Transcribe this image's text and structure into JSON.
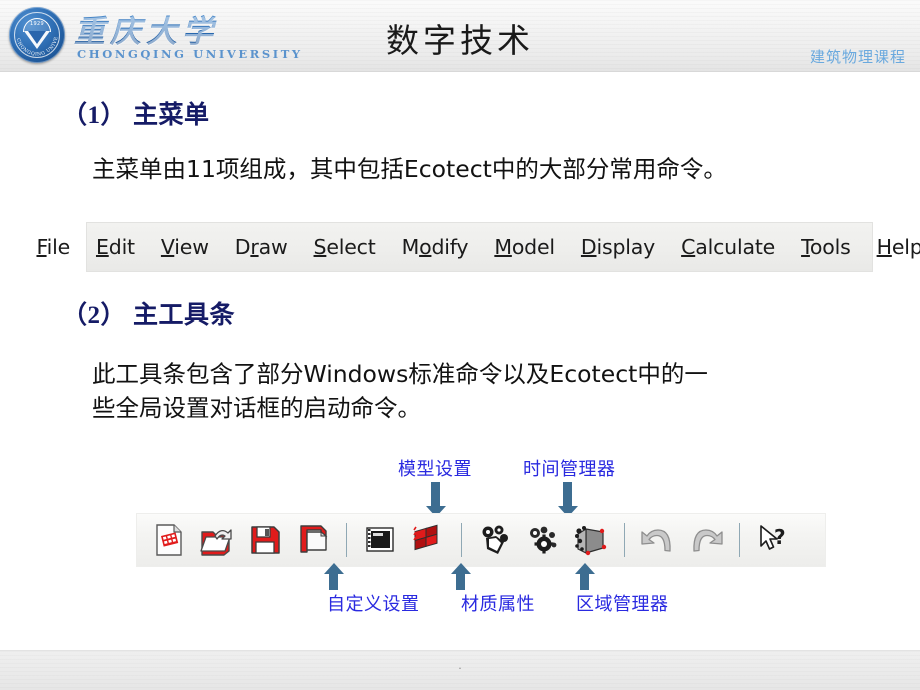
{
  "header": {
    "title": "数字技术",
    "course_label": "建筑物理课程",
    "logo": {
      "seal_year": "1929",
      "seal_arc_text": "CHONGQING UNIVERSITY",
      "wordmark_cn": "重庆大学",
      "wordmark_en": "CHONGQING UNIVERSITY"
    }
  },
  "sections": [
    {
      "number": "（1）",
      "title": "主菜单",
      "paragraph": "主菜单由11项组成，其中包括Ecotect中的大部分常用命令。"
    },
    {
      "number": "（2）",
      "title": "主工具条",
      "paragraph": "此工具条包含了部分Windows标准命令以及Ecotect中的一\n些全局设置对话框的启动命令。"
    }
  ],
  "menubar": {
    "items": [
      {
        "label": "File",
        "pre": "",
        "accel": "F",
        "post": "ile"
      },
      {
        "label": "Edit",
        "pre": "",
        "accel": "E",
        "post": "dit"
      },
      {
        "label": "View",
        "pre": "",
        "accel": "V",
        "post": "iew"
      },
      {
        "label": "Draw",
        "pre": "D",
        "accel": "r",
        "post": "aw"
      },
      {
        "label": "Select",
        "pre": "",
        "accel": "S",
        "post": "elect"
      },
      {
        "label": "Modify",
        "pre": "M",
        "accel": "o",
        "post": "dify"
      },
      {
        "label": "Model",
        "pre": "",
        "accel": "M",
        "post": "odel"
      },
      {
        "label": "Display",
        "pre": "",
        "accel": "D",
        "post": "isplay"
      },
      {
        "label": "Calculate",
        "pre": "",
        "accel": "C",
        "post": "alculate"
      },
      {
        "label": "Tools",
        "pre": "",
        "accel": "T",
        "post": "ools"
      },
      {
        "label": "Help",
        "pre": "",
        "accel": "H",
        "post": "elp"
      }
    ]
  },
  "toolbar": {
    "buttons": [
      {
        "icon": "new-document-icon"
      },
      {
        "icon": "open-folder-icon"
      },
      {
        "icon": "save-floppy-icon"
      },
      {
        "icon": "save-as-icon"
      },
      {
        "icon": "custom-settings-icon"
      },
      {
        "icon": "model-settings-icon"
      },
      {
        "icon": "material-properties-icon"
      },
      {
        "icon": "time-manager-icon"
      },
      {
        "icon": "zone-manager-icon"
      },
      {
        "icon": "undo-icon"
      },
      {
        "icon": "redo-icon"
      },
      {
        "icon": "context-help-icon"
      }
    ]
  },
  "annotations": {
    "top": [
      {
        "text": "模型设置"
      },
      {
        "text": "时间管理器"
      }
    ],
    "bottom": [
      {
        "text": "自定义设置"
      },
      {
        "text": "材质属性"
      },
      {
        "text": "区域管理器"
      }
    ]
  },
  "footer": {
    "text": "."
  },
  "colors": {
    "heading": "#151b66",
    "annotation": "#2a2ae0",
    "course": "#6aa9de",
    "arrow": "#3d6d91",
    "icon_red": "#e01b1b"
  }
}
